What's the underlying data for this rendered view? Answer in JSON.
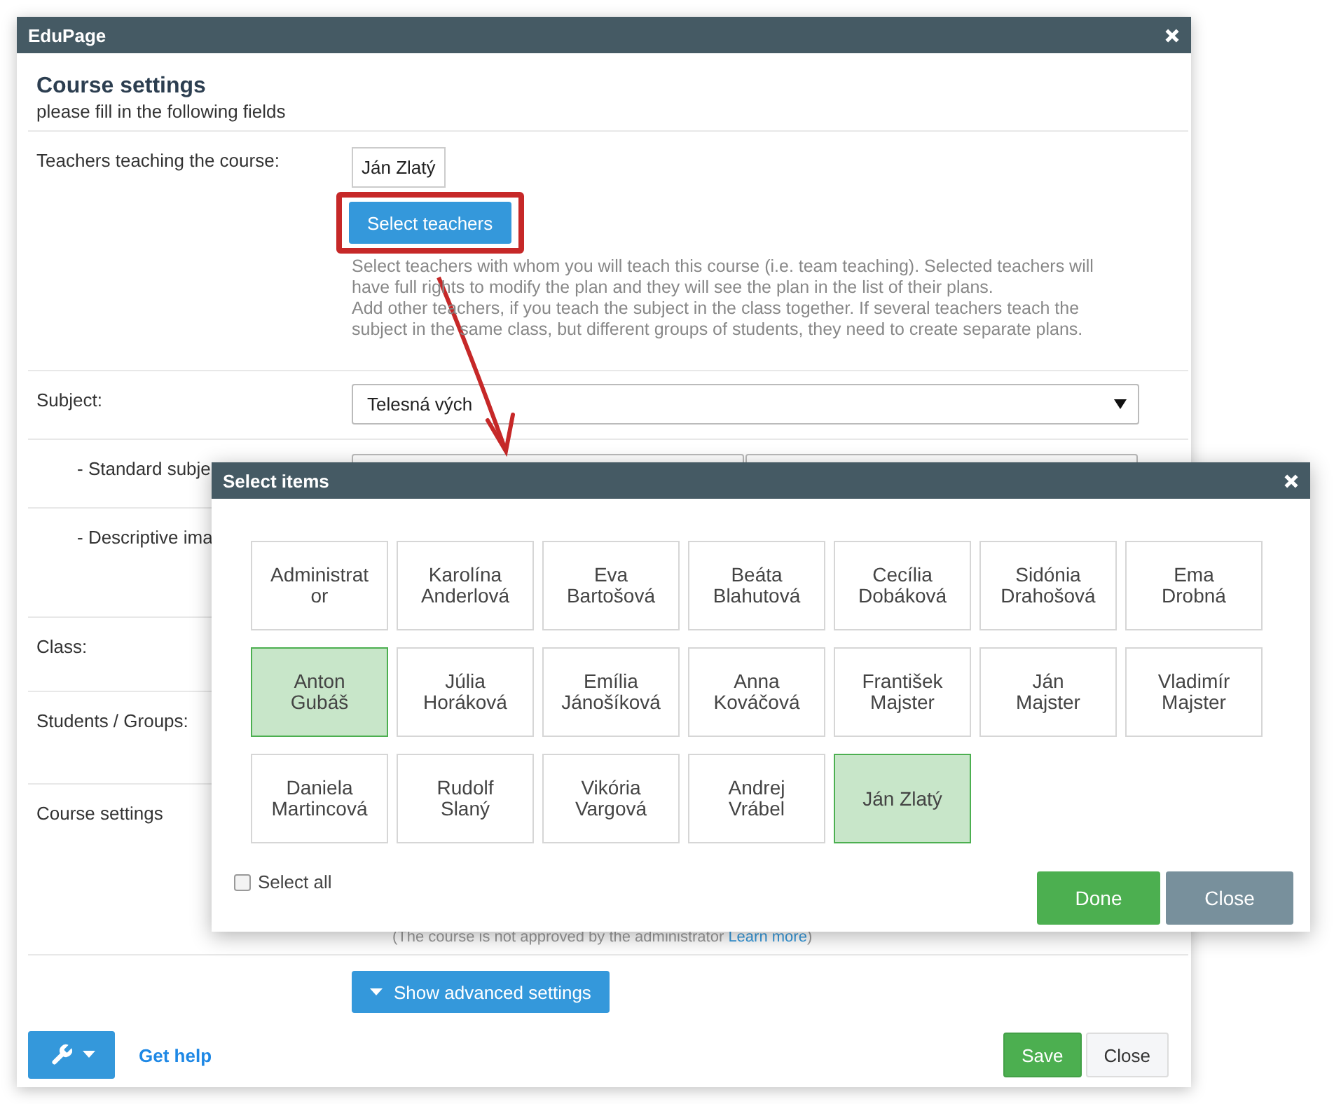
{
  "dialog": {
    "title": "EduPage",
    "heading": "Course settings",
    "subheading": "please fill in the following fields",
    "rows": [
      {
        "kind": "teachers",
        "label": "Teachers teaching the course:",
        "chip": "Ján Zlatý",
        "button": "Select teachers",
        "help": [
          "Select teachers with whom you will teach this course (i.e. team teaching). Selected teachers will have full rights to modify the plan and they will see the plan in the list of their plans.",
          "Add other teachers, if you teach the subject in the class together. If several teachers teach the subject in the same class, but different groups of students, they need to create separate plans."
        ]
      },
      {
        "kind": "select",
        "label": "Subject:",
        "value": "Telesná vých"
      },
      {
        "kind": "pair",
        "label": "- Standard subje"
      },
      {
        "kind": "plain",
        "label": "- Descriptive ima"
      },
      {
        "kind": "plain",
        "label": "Class:"
      },
      {
        "kind": "plain",
        "label": "Students / Groups:"
      },
      {
        "kind": "note",
        "label": "Course settings",
        "note": "(The course is not approved by the administrator",
        "link": "Learn more",
        "note_end": ")"
      },
      {
        "kind": "advanced",
        "button": "Show advanced settings"
      }
    ],
    "footer": {
      "help_link": "Get help",
      "buttons": [
        {
          "label": "Save",
          "kind": "primary"
        },
        {
          "label": "Close",
          "kind": "default"
        }
      ]
    }
  },
  "picker": {
    "title": "Select items",
    "select_all": {
      "label": "Select all",
      "checked": false
    },
    "items": [
      {
        "label": "Administrator",
        "selected": false
      },
      {
        "label": "Karolína Anderlová",
        "selected": false
      },
      {
        "label": "Eva Bartošová",
        "selected": false
      },
      {
        "label": "Beáta Blahutová",
        "selected": false
      },
      {
        "label": "Cecília Dobáková",
        "selected": false
      },
      {
        "label": "Sidónia Drahošová",
        "selected": false
      },
      {
        "label": "Ema Drobná",
        "selected": false
      },
      {
        "label": "Anton Gubáš",
        "selected": true
      },
      {
        "label": "Júlia Horáková",
        "selected": false
      },
      {
        "label": "Emília Jánošíková",
        "selected": false
      },
      {
        "label": "Anna Kováčová",
        "selected": false
      },
      {
        "label": "František Majster",
        "selected": false
      },
      {
        "label": "Ján Majster",
        "selected": false
      },
      {
        "label": "Vladimír Majster",
        "selected": false
      },
      {
        "label": "Daniela Martincová",
        "selected": false
      },
      {
        "label": "Rudolf Slaný",
        "selected": false
      },
      {
        "label": "Vikória Vargová",
        "selected": false
      },
      {
        "label": "Andrej Vrábel",
        "selected": false
      },
      {
        "label": "Ján Zlatý",
        "selected": true
      }
    ],
    "buttons": [
      {
        "label": "Done",
        "kind": "primary"
      },
      {
        "label": "Close",
        "kind": "secondary"
      }
    ]
  }
}
